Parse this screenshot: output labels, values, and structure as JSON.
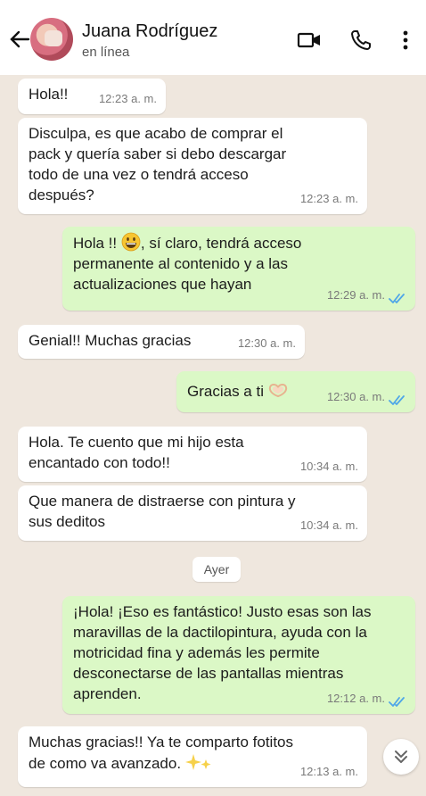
{
  "header": {
    "name": "Juana Rodríguez",
    "status": "en línea",
    "icons": [
      "back-arrow-icon",
      "video-call-icon",
      "phone-icon",
      "more-options-icon"
    ]
  },
  "messages": [
    {
      "dir": "in",
      "text": "Hola!!",
      "time": "12:23 a. m."
    },
    {
      "dir": "in",
      "text": "Disculpa, es que acabo de comprar el pack y quería saber si debo descargar todo de una vez o tendrá acceso después?",
      "time": "12:23 a. m."
    },
    {
      "dir": "out",
      "text_before": "Hola !!",
      "emoji": "grinning-face-emoji",
      "text_after": ", sí claro, tendrá acceso permanente al contenido y a las actualizaciones que hayan",
      "time": "12:29 a. m."
    },
    {
      "dir": "in",
      "text": "Genial!! Muchas gracias",
      "time": "12:30 a. m."
    },
    {
      "dir": "out",
      "text": "Gracias a ti",
      "emoji": "heart-hands-emoji",
      "time": "12:30 a. m."
    },
    {
      "dir": "in",
      "text": "Hola. Te cuento que mi hijo esta encantado con todo!!",
      "time": "10:34 a. m."
    },
    {
      "dir": "in",
      "text": "Que manera de distraerse con pintura y sus deditos",
      "time": "10:34 a. m."
    },
    {
      "dir": "out",
      "text": "¡Hola! ¡Eso es fantástico! Justo esas son las maravillas de la dactilopintura, ayuda con la motricidad fina y además les permite desconectarse de las pantallas mientras aprenden.",
      "time": "12:12 a. m."
    },
    {
      "dir": "in",
      "text": "Muchas gracias!! Ya te comparto fotitos de como va avanzado.",
      "emoji": "sparkles-emoji",
      "time": "12:13 a. m."
    }
  ],
  "day_separator": "Ayer",
  "colors": {
    "incoming": "#ffffff",
    "outgoing": "#dbf8c6",
    "read_ticks": "#4fa6e8",
    "background": "#efe7de"
  }
}
